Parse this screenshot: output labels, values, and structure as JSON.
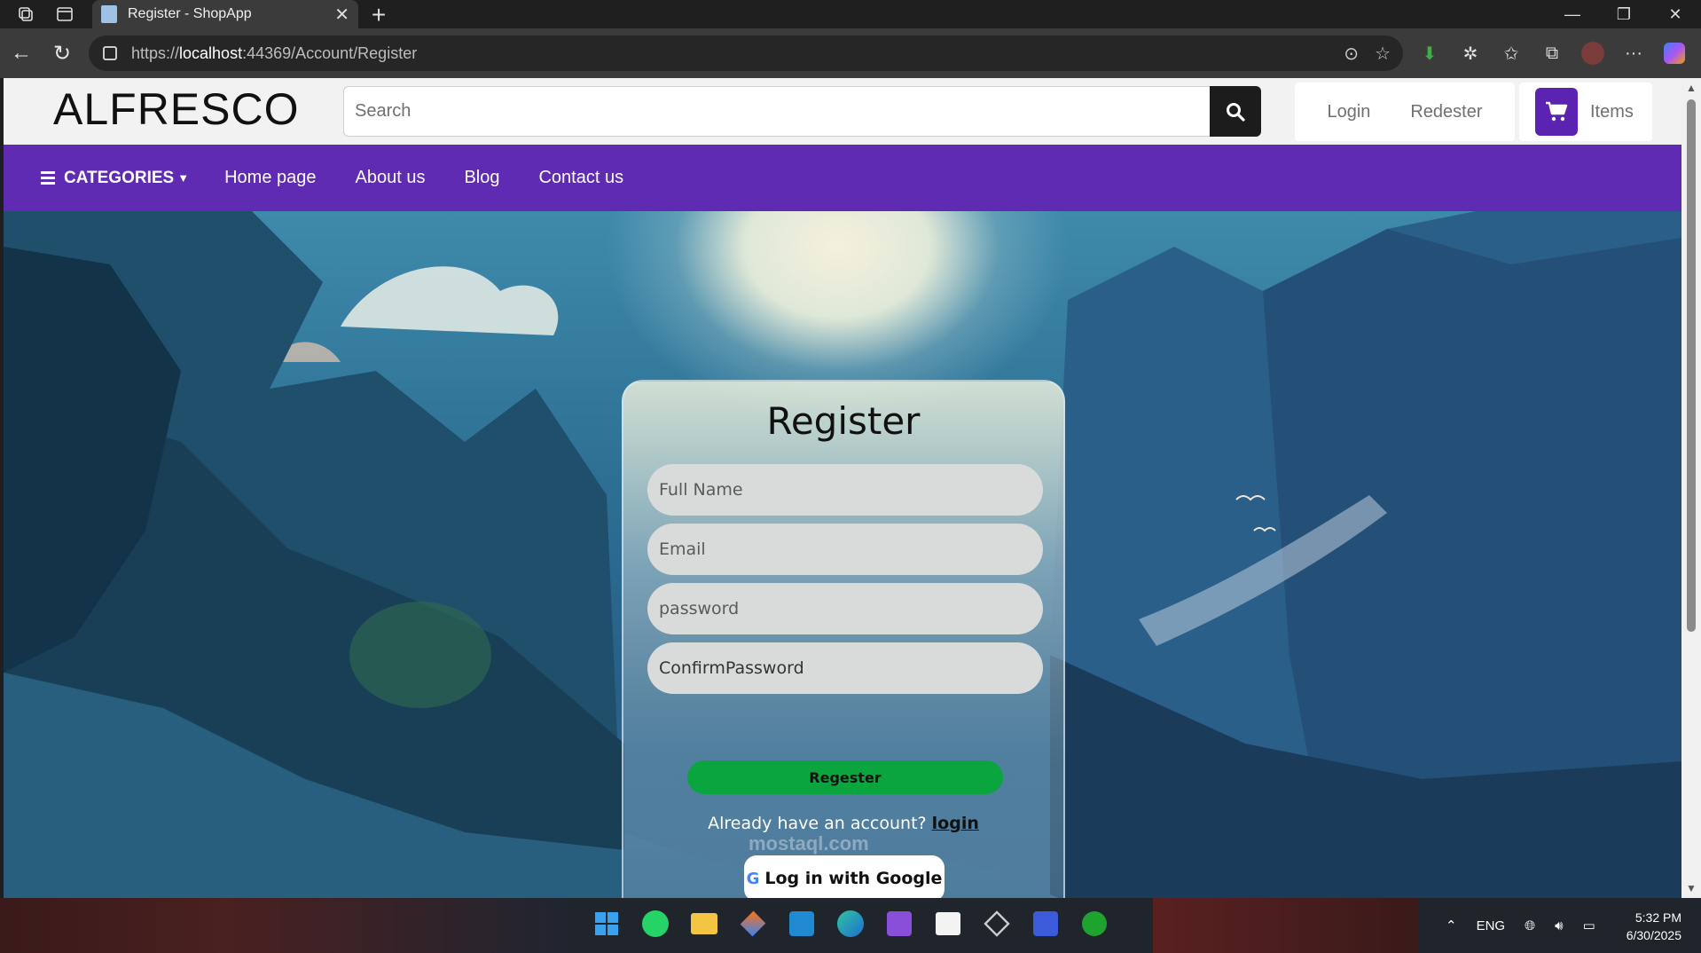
{
  "browser": {
    "tab_title": "Register - ShopApp",
    "url_prefix": "https://",
    "url_host": "localhost",
    "url_rest": ":44369/Account/Register"
  },
  "site": {
    "logo": "ALFRESCO",
    "search_placeholder": "Search",
    "login": "Login",
    "register": "Redester",
    "cart_label": "Items",
    "nav": {
      "categories": "CATEGORIES",
      "home": "Home page",
      "about": "About us",
      "blog": "Blog",
      "contact": "Contact us"
    }
  },
  "form": {
    "title": "Register",
    "full_name_placeholder": "Full Name",
    "email_placeholder": "Email",
    "password_placeholder": "password",
    "confirm_value": "ConfirmPassword",
    "submit": "Regester",
    "have_account": "Already have an account? ",
    "login_link": "login",
    "google": "Log in with Google"
  },
  "watermark": "mostaql.com",
  "taskbar": {
    "lang": "ENG",
    "time": "5:32 PM",
    "date": "6/30/2025"
  },
  "colors": {
    "nav_purple": "#5f2bb3",
    "cart_purple": "#5b24b0",
    "register_green": "#0ba540"
  }
}
